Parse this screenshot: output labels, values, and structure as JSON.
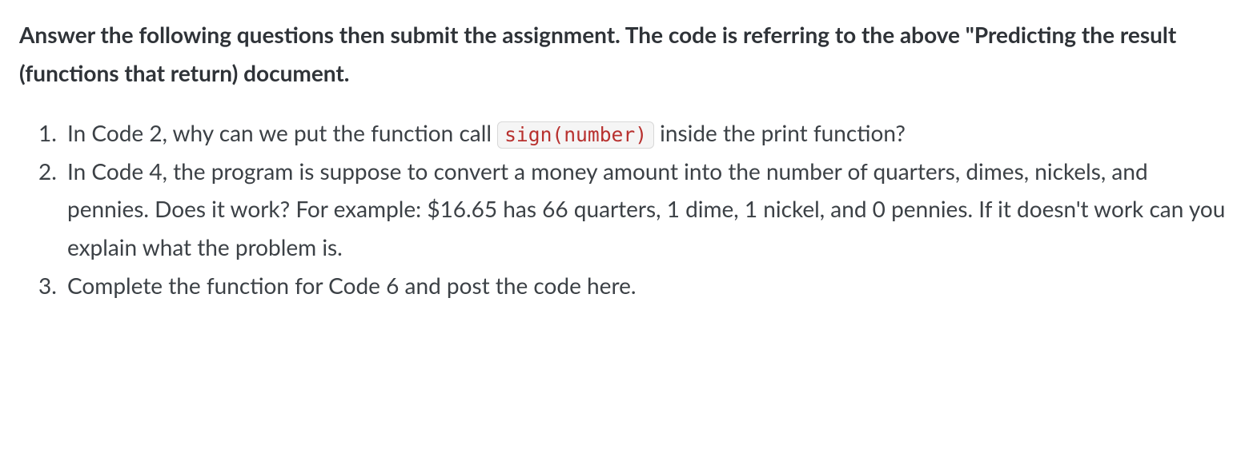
{
  "intro": "Answer the following questions then submit the assignment.  The code is referring to the above \"Predicting the result (functions that return) document.",
  "questions": {
    "q1_pre": "In Code 2, why can we put the function call ",
    "q1_code": "sign(number)",
    "q1_post": " inside the print function?",
    "q2": "In Code 4, the program is suppose to convert a money amount into the number of quarters, dimes, nickels, and pennies.  Does it work?  For example: $16.65 has 66 quarters, 1 dime, 1 nickel, and 0 pennies.  If it doesn't work can you explain what the problem is.",
    "q3": "Complete the function for Code 6 and post the code here."
  }
}
